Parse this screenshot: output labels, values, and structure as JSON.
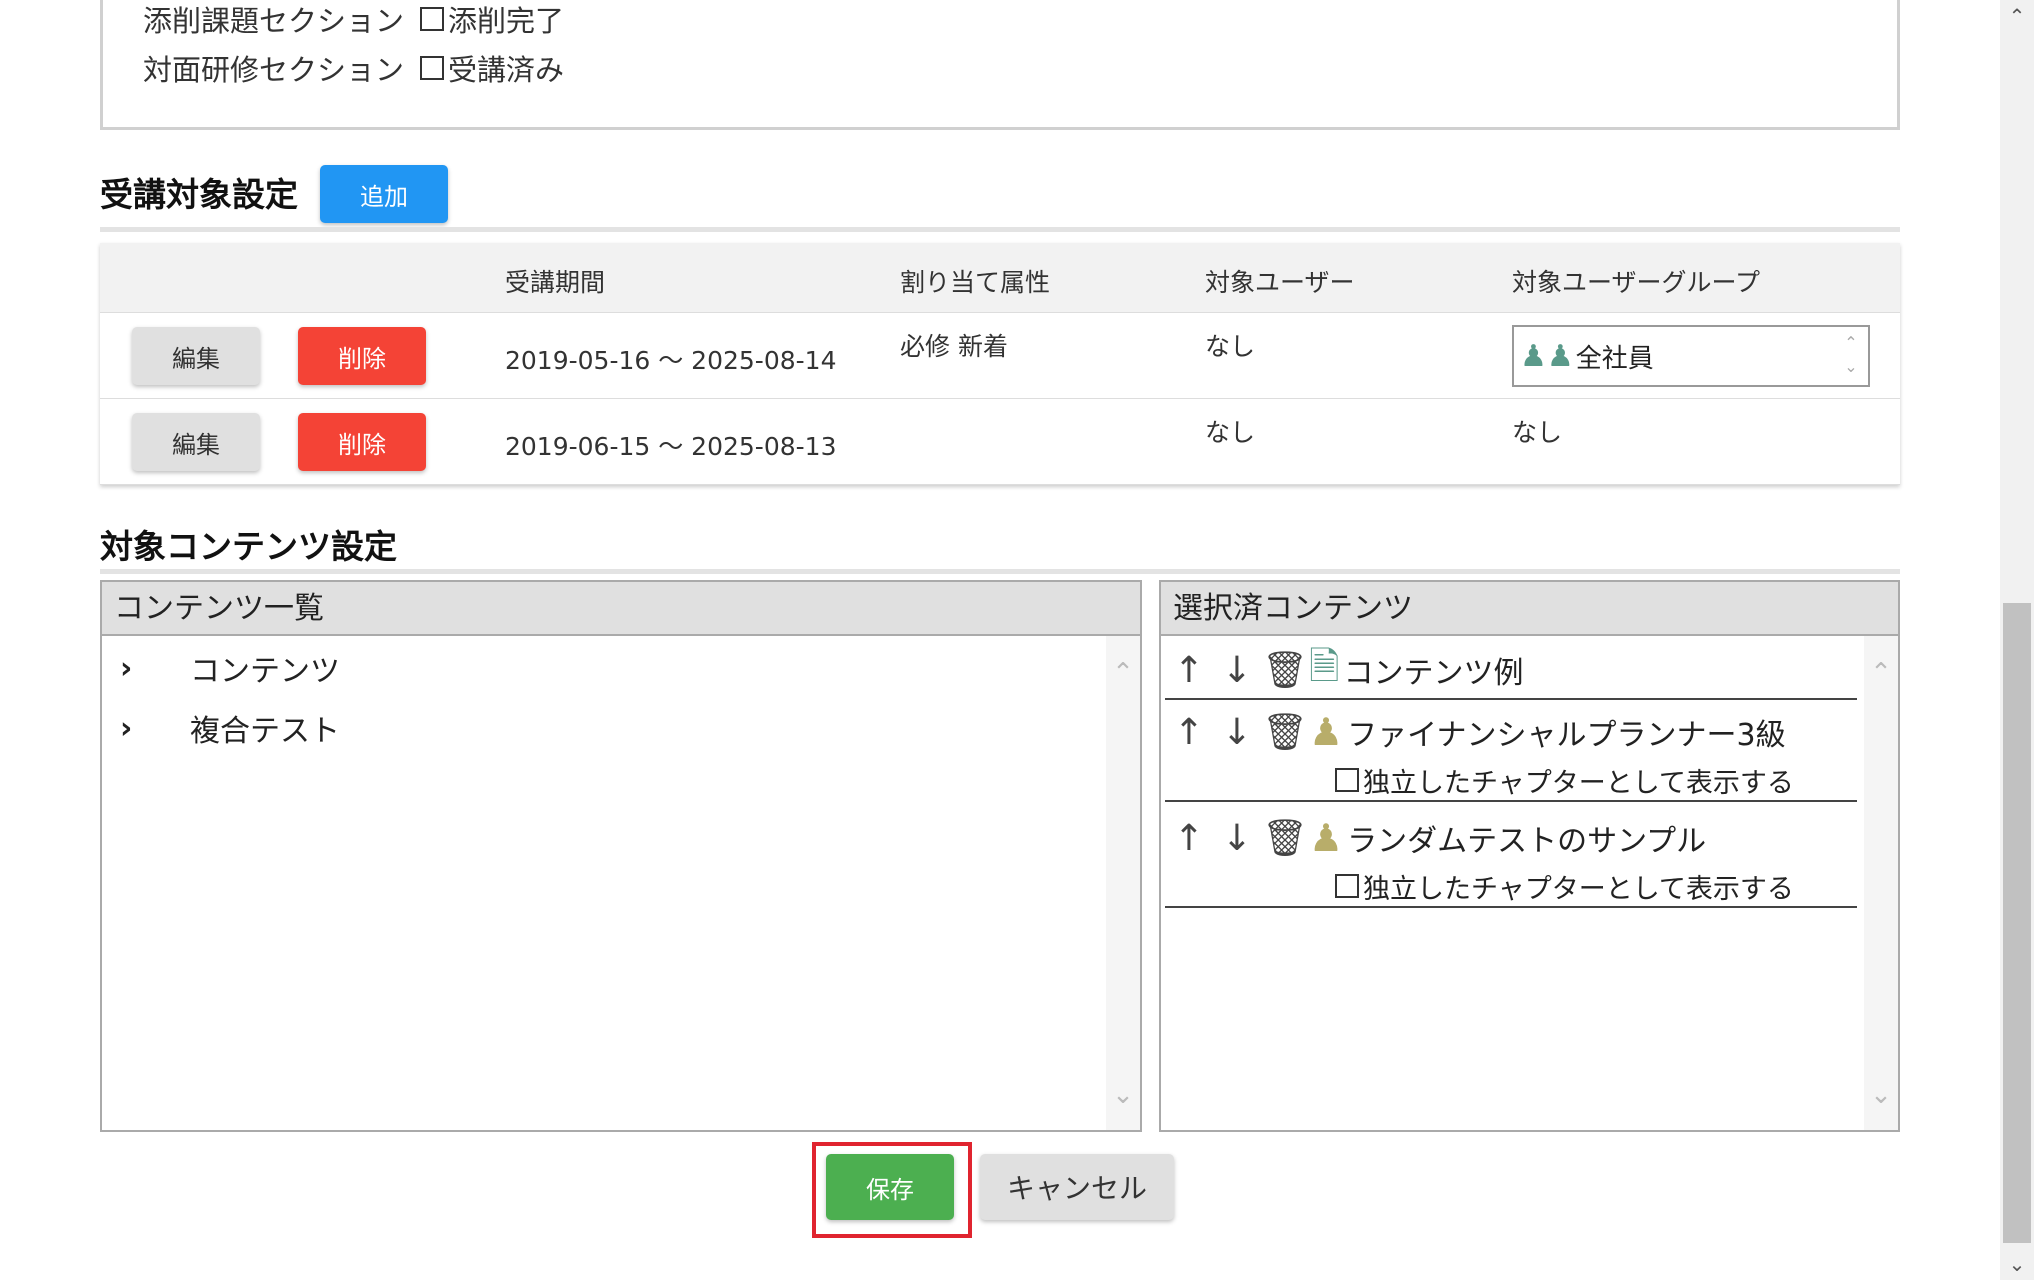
{
  "completion": {
    "rows": [
      {
        "section": "添削課題セクション",
        "checkbox_label": "添削完了"
      },
      {
        "section": "対面研修セクション",
        "checkbox_label": "受講済み"
      }
    ]
  },
  "target_settings": {
    "title": "受講対象設定",
    "add_label": "追加",
    "columns": [
      "受講期間",
      "割り当て属性",
      "対象ユーザー",
      "対象ユーザーグループ"
    ],
    "edit_label": "編集",
    "delete_label": "削除",
    "rows": [
      {
        "period": "2019-05-16 ～ 2025-08-14",
        "attributes": "必修 新着",
        "users": "なし",
        "group": "全社員"
      },
      {
        "period": "2019-06-15 ～ 2025-08-13",
        "attributes": "",
        "users": "なし",
        "group": "なし"
      }
    ]
  },
  "content_settings": {
    "title": "対象コンテンツ設定",
    "list_header": "コンテンツ一覧",
    "list_items": [
      "コンテンツ",
      "複合テスト"
    ],
    "selected_header": "選択済コンテンツ",
    "selected_items": [
      {
        "name": "コンテンツ例",
        "type": "content"
      },
      {
        "name": "ファイナンシャルプランナー3級",
        "type": "test",
        "option": "独立したチャプターとして表示する"
      },
      {
        "name": "ランダムテストのサンプル",
        "type": "test",
        "option": "独立したチャプターとして表示する"
      }
    ]
  },
  "footer": {
    "save_label": "保存",
    "cancel_label": "キャンセル"
  },
  "colors": {
    "primary": "#2196f3",
    "danger": "#f44336",
    "success": "#4caf50",
    "highlight": "#e0242f"
  }
}
